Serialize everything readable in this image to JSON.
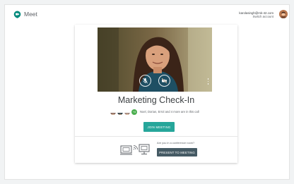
{
  "app": {
    "name": "Meet"
  },
  "account": {
    "email": "karolasingh@mk-42.com",
    "switch_label": "Switch account"
  },
  "meeting": {
    "title": "Marketing Check-In",
    "participants_text": "Noel, Dorian, Errol and 4 more are in this call",
    "more_count": "+4"
  },
  "actions": {
    "join_label": "JOIN MEETING",
    "present_question": "Are you in a conference room?",
    "present_label": "PRESENT TO MEETING"
  },
  "colors": {
    "join": "#26a69a",
    "present": "#455a64",
    "logo": "#00897b"
  },
  "icons": [
    "meet-logo-icon",
    "mic-off-icon",
    "camera-off-icon",
    "more-vert-icon",
    "conference-room-icon"
  ]
}
